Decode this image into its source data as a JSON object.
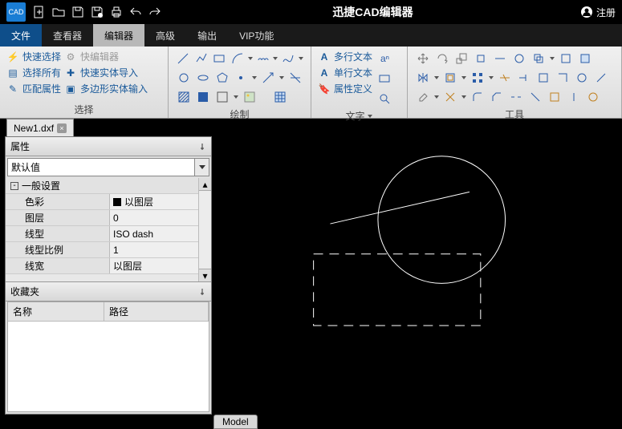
{
  "titlebar": {
    "app_title": "迅捷CAD编辑器",
    "logo": "CAD",
    "register": "注册"
  },
  "menu": {
    "file": "文件",
    "viewer": "查看器",
    "editor": "编辑器",
    "advanced": "高级",
    "output": "输出",
    "vip": "VIP功能"
  },
  "ribbon": {
    "select": {
      "label": "选择",
      "quick": "快速选择",
      "quick_edit": "快编辑器",
      "select_all": "选择所有",
      "import": "快速实体导入",
      "match": "匹配属性",
      "polygon": "多边形实体输入"
    },
    "draw": {
      "label": "绘制"
    },
    "text": {
      "label": "文字",
      "multi": "多行文本",
      "single": "单行文本",
      "attr": "属性定义"
    },
    "tools": {
      "label": "工具"
    }
  },
  "doc_tab": "New1.dxf",
  "panels": {
    "props": {
      "title": "属性",
      "combo": "默认值",
      "section": "一般设置",
      "rows": [
        {
          "k": "色彩",
          "v": "以图层",
          "swatch": true
        },
        {
          "k": "图层",
          "v": "0"
        },
        {
          "k": "线型",
          "v": "ISO dash"
        },
        {
          "k": "线型比例",
          "v": "1"
        },
        {
          "k": "线宽",
          "v": "以图层"
        }
      ]
    },
    "fav": {
      "title": "收藏夹",
      "col1": "名称",
      "col2": "路径"
    }
  },
  "bottom_tab": "Model"
}
